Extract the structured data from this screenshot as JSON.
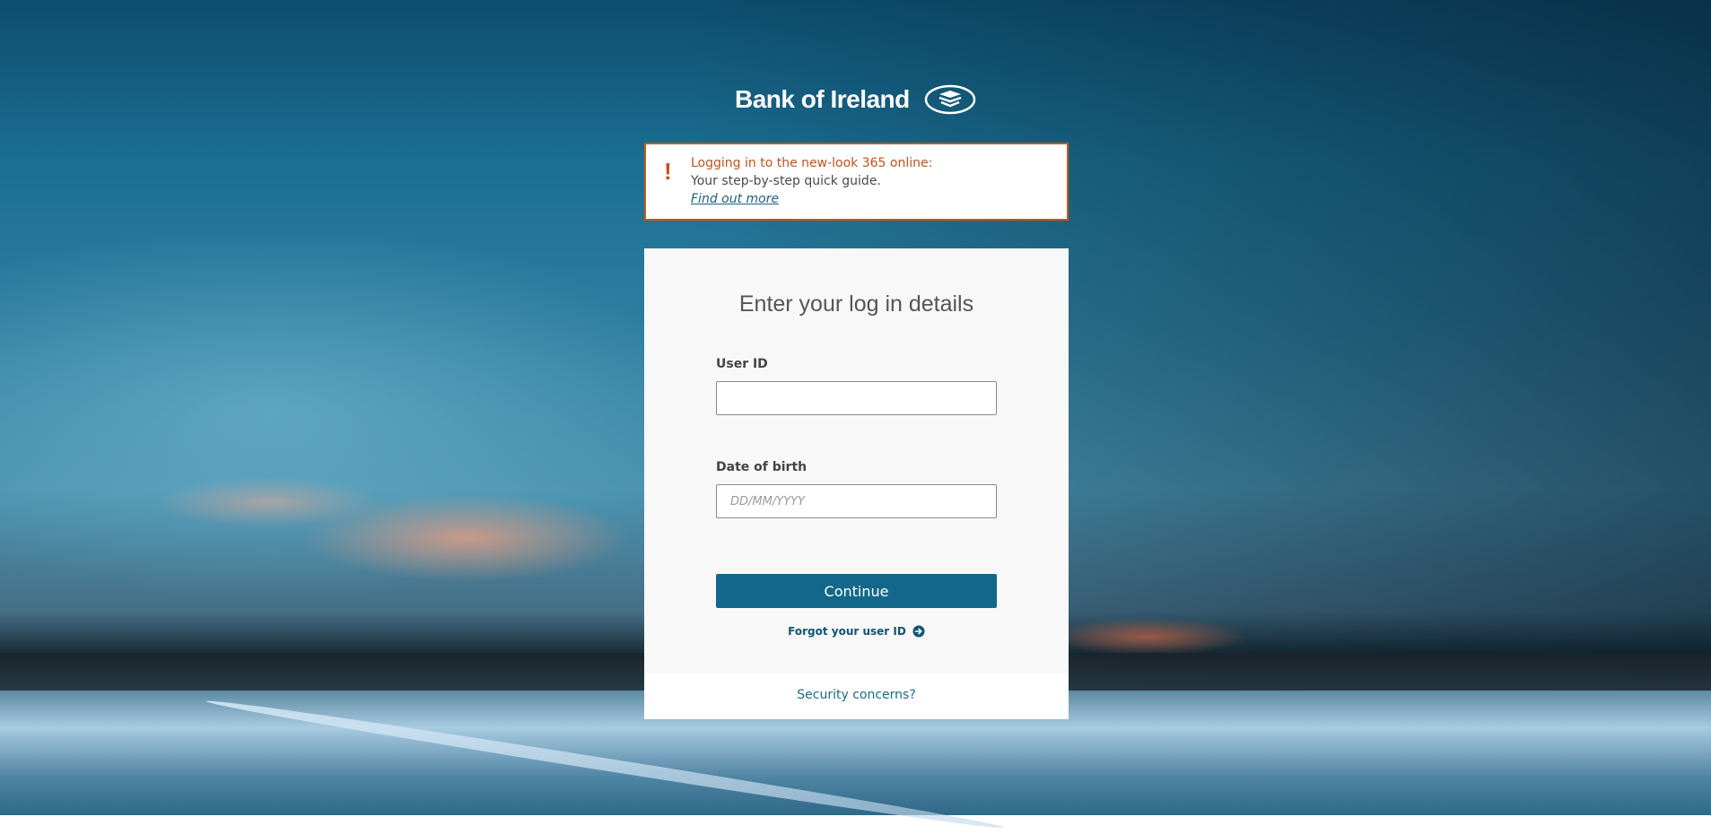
{
  "brand": {
    "name": "Bank of Ireland",
    "logo_icon": "boi-tree-icon"
  },
  "notice": {
    "icon": "exclamation-icon",
    "title": "Logging in to the new-look 365 online:",
    "body": "Your step-by-step quick guide.",
    "link": "Find out more",
    "border_color": "#c25a14"
  },
  "login": {
    "title": "Enter your log in details",
    "user_id_label": "User ID",
    "user_id_value": "",
    "dob_label": "Date of birth",
    "dob_placeholder": "DD/MM/YYYY",
    "dob_value": "",
    "continue_label": "Continue",
    "forgot_label": "Forgot your user ID",
    "forgot_icon": "arrow-circle-right-icon",
    "button_color": "#13678a"
  },
  "footer": {
    "security_label": "Security concerns?"
  }
}
